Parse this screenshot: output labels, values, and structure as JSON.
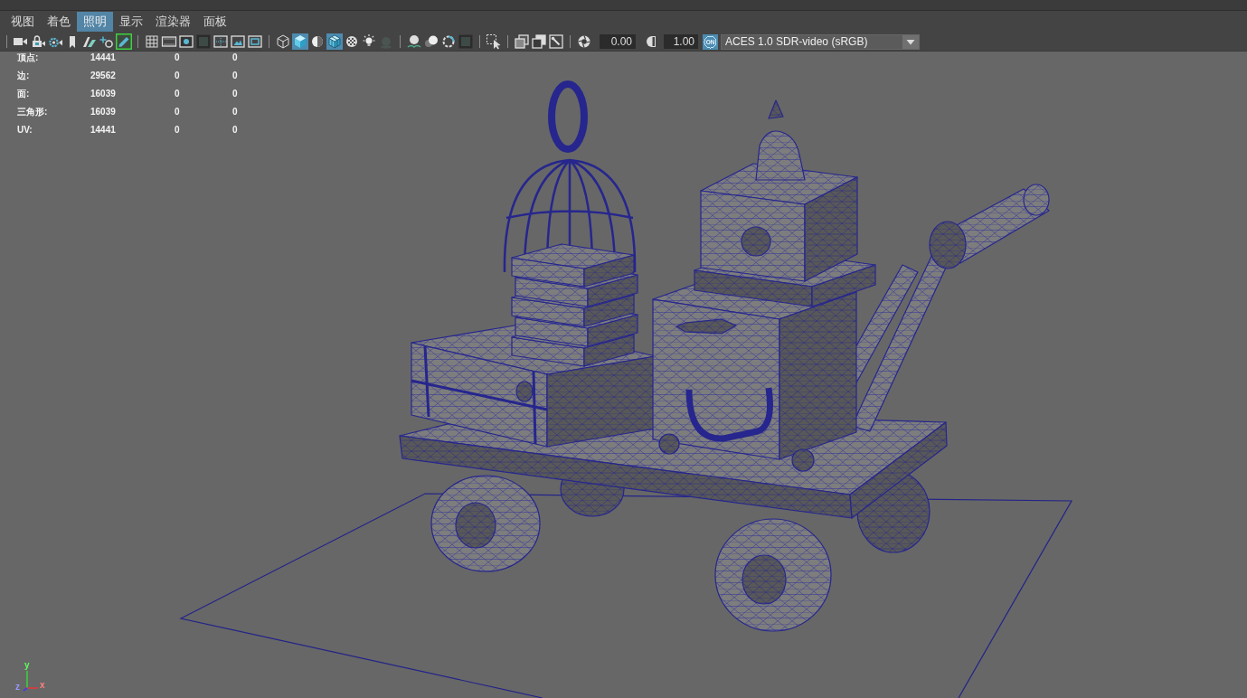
{
  "menu_bar": {
    "items": [
      {
        "label": "视图",
        "selected": false
      },
      {
        "label": "着色",
        "selected": false
      },
      {
        "label": "照明",
        "selected": true
      },
      {
        "label": "显示",
        "selected": false
      },
      {
        "label": "渲染器",
        "selected": false
      },
      {
        "label": "面板",
        "selected": false
      }
    ]
  },
  "toolbar": {
    "groups": [
      [
        {
          "kind": "camera",
          "on": false
        },
        {
          "kind": "locked_camera",
          "on": false
        },
        {
          "kind": "camera_gear",
          "on": false
        },
        {
          "kind": "bookmark",
          "on": false
        },
        {
          "kind": "image_plane",
          "on": false
        },
        {
          "kind": "pan_zoom",
          "on": false
        },
        {
          "kind": "pencil",
          "on": true
        }
      ],
      [
        {
          "kind": "grid",
          "on": false
        },
        {
          "kind": "film_gate",
          "on": false
        },
        {
          "kind": "resolution_gate",
          "on": false
        },
        {
          "kind": "gate_mask",
          "on": false
        },
        {
          "kind": "field_chart",
          "on": false
        },
        {
          "kind": "safe_action",
          "on": false
        },
        {
          "kind": "safe_title",
          "on": false
        }
      ],
      [
        {
          "kind": "wireframe",
          "on": false
        },
        {
          "kind": "smooth_shade",
          "on": true
        },
        {
          "kind": "default_material",
          "on": false
        },
        {
          "kind": "wireframe_on_shaded",
          "on": true
        },
        {
          "kind": "checker",
          "on": false
        },
        {
          "kind": "lights",
          "on": false
        },
        {
          "kind": "shadows",
          "on": false
        }
      ],
      [
        {
          "kind": "ambient_occlusion",
          "on": false
        },
        {
          "kind": "motion_blur",
          "on": false
        },
        {
          "kind": "anti_aliasing",
          "on": false
        },
        {
          "kind": "depth_of_field",
          "on": false
        }
      ],
      [
        {
          "kind": "isolate_select",
          "on": false
        }
      ],
      [
        {
          "kind": "xray_mode",
          "on": false
        },
        {
          "kind": "xray_active",
          "on": false
        },
        {
          "kind": "xray_joints",
          "on": false
        }
      ]
    ],
    "exposure": {
      "value": "0.00"
    },
    "gamma": {
      "value": "1.00"
    },
    "color_management": {
      "label": "ON",
      "on": true
    },
    "view_transform": {
      "value": "ACES 1.0 SDR-video (sRGB)"
    }
  },
  "stats": [
    {
      "label": "顶点:",
      "values": [
        "14441",
        "0",
        "0"
      ]
    },
    {
      "label": "边:",
      "values": [
        "29562",
        "0",
        "0"
      ]
    },
    {
      "label": "面:",
      "values": [
        "16039",
        "0",
        "0"
      ]
    },
    {
      "label": "三角形:",
      "values": [
        "16039",
        "0",
        "0"
      ]
    },
    {
      "label": "UV:",
      "values": [
        "14441",
        "0",
        "0"
      ]
    }
  ],
  "axis_gizmo": {
    "x": "x",
    "y": "y",
    "z": "z"
  }
}
